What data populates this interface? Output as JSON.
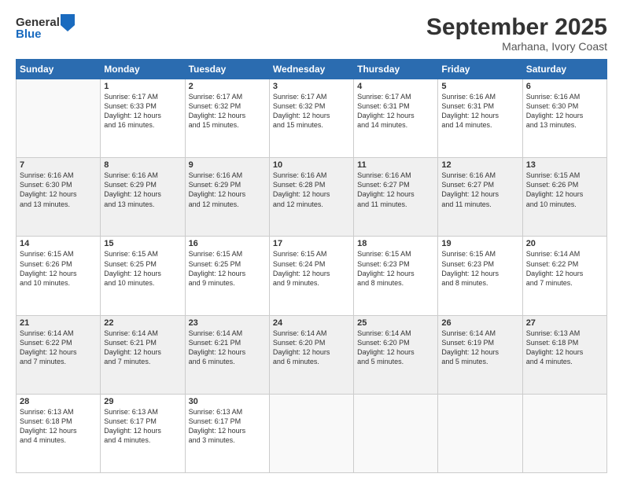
{
  "header": {
    "logo_general": "General",
    "logo_blue": "Blue",
    "title": "September 2025",
    "subtitle": "Marhana, Ivory Coast"
  },
  "days_of_week": [
    "Sunday",
    "Monday",
    "Tuesday",
    "Wednesday",
    "Thursday",
    "Friday",
    "Saturday"
  ],
  "weeks": [
    [
      {
        "num": "",
        "info": ""
      },
      {
        "num": "1",
        "info": "Sunrise: 6:17 AM\nSunset: 6:33 PM\nDaylight: 12 hours\nand 16 minutes."
      },
      {
        "num": "2",
        "info": "Sunrise: 6:17 AM\nSunset: 6:32 PM\nDaylight: 12 hours\nand 15 minutes."
      },
      {
        "num": "3",
        "info": "Sunrise: 6:17 AM\nSunset: 6:32 PM\nDaylight: 12 hours\nand 15 minutes."
      },
      {
        "num": "4",
        "info": "Sunrise: 6:17 AM\nSunset: 6:31 PM\nDaylight: 12 hours\nand 14 minutes."
      },
      {
        "num": "5",
        "info": "Sunrise: 6:16 AM\nSunset: 6:31 PM\nDaylight: 12 hours\nand 14 minutes."
      },
      {
        "num": "6",
        "info": "Sunrise: 6:16 AM\nSunset: 6:30 PM\nDaylight: 12 hours\nand 13 minutes."
      }
    ],
    [
      {
        "num": "7",
        "info": "Sunrise: 6:16 AM\nSunset: 6:30 PM\nDaylight: 12 hours\nand 13 minutes."
      },
      {
        "num": "8",
        "info": "Sunrise: 6:16 AM\nSunset: 6:29 PM\nDaylight: 12 hours\nand 13 minutes."
      },
      {
        "num": "9",
        "info": "Sunrise: 6:16 AM\nSunset: 6:29 PM\nDaylight: 12 hours\nand 12 minutes."
      },
      {
        "num": "10",
        "info": "Sunrise: 6:16 AM\nSunset: 6:28 PM\nDaylight: 12 hours\nand 12 minutes."
      },
      {
        "num": "11",
        "info": "Sunrise: 6:16 AM\nSunset: 6:27 PM\nDaylight: 12 hours\nand 11 minutes."
      },
      {
        "num": "12",
        "info": "Sunrise: 6:16 AM\nSunset: 6:27 PM\nDaylight: 12 hours\nand 11 minutes."
      },
      {
        "num": "13",
        "info": "Sunrise: 6:15 AM\nSunset: 6:26 PM\nDaylight: 12 hours\nand 10 minutes."
      }
    ],
    [
      {
        "num": "14",
        "info": "Sunrise: 6:15 AM\nSunset: 6:26 PM\nDaylight: 12 hours\nand 10 minutes."
      },
      {
        "num": "15",
        "info": "Sunrise: 6:15 AM\nSunset: 6:25 PM\nDaylight: 12 hours\nand 10 minutes."
      },
      {
        "num": "16",
        "info": "Sunrise: 6:15 AM\nSunset: 6:25 PM\nDaylight: 12 hours\nand 9 minutes."
      },
      {
        "num": "17",
        "info": "Sunrise: 6:15 AM\nSunset: 6:24 PM\nDaylight: 12 hours\nand 9 minutes."
      },
      {
        "num": "18",
        "info": "Sunrise: 6:15 AM\nSunset: 6:23 PM\nDaylight: 12 hours\nand 8 minutes."
      },
      {
        "num": "19",
        "info": "Sunrise: 6:15 AM\nSunset: 6:23 PM\nDaylight: 12 hours\nand 8 minutes."
      },
      {
        "num": "20",
        "info": "Sunrise: 6:14 AM\nSunset: 6:22 PM\nDaylight: 12 hours\nand 7 minutes."
      }
    ],
    [
      {
        "num": "21",
        "info": "Sunrise: 6:14 AM\nSunset: 6:22 PM\nDaylight: 12 hours\nand 7 minutes."
      },
      {
        "num": "22",
        "info": "Sunrise: 6:14 AM\nSunset: 6:21 PM\nDaylight: 12 hours\nand 7 minutes."
      },
      {
        "num": "23",
        "info": "Sunrise: 6:14 AM\nSunset: 6:21 PM\nDaylight: 12 hours\nand 6 minutes."
      },
      {
        "num": "24",
        "info": "Sunrise: 6:14 AM\nSunset: 6:20 PM\nDaylight: 12 hours\nand 6 minutes."
      },
      {
        "num": "25",
        "info": "Sunrise: 6:14 AM\nSunset: 6:20 PM\nDaylight: 12 hours\nand 5 minutes."
      },
      {
        "num": "26",
        "info": "Sunrise: 6:14 AM\nSunset: 6:19 PM\nDaylight: 12 hours\nand 5 minutes."
      },
      {
        "num": "27",
        "info": "Sunrise: 6:13 AM\nSunset: 6:18 PM\nDaylight: 12 hours\nand 4 minutes."
      }
    ],
    [
      {
        "num": "28",
        "info": "Sunrise: 6:13 AM\nSunset: 6:18 PM\nDaylight: 12 hours\nand 4 minutes."
      },
      {
        "num": "29",
        "info": "Sunrise: 6:13 AM\nSunset: 6:17 PM\nDaylight: 12 hours\nand 4 minutes."
      },
      {
        "num": "30",
        "info": "Sunrise: 6:13 AM\nSunset: 6:17 PM\nDaylight: 12 hours\nand 3 minutes."
      },
      {
        "num": "",
        "info": ""
      },
      {
        "num": "",
        "info": ""
      },
      {
        "num": "",
        "info": ""
      },
      {
        "num": "",
        "info": ""
      }
    ]
  ],
  "row_styles": [
    "row-white",
    "row-shaded",
    "row-white",
    "row-shaded",
    "row-white"
  ]
}
